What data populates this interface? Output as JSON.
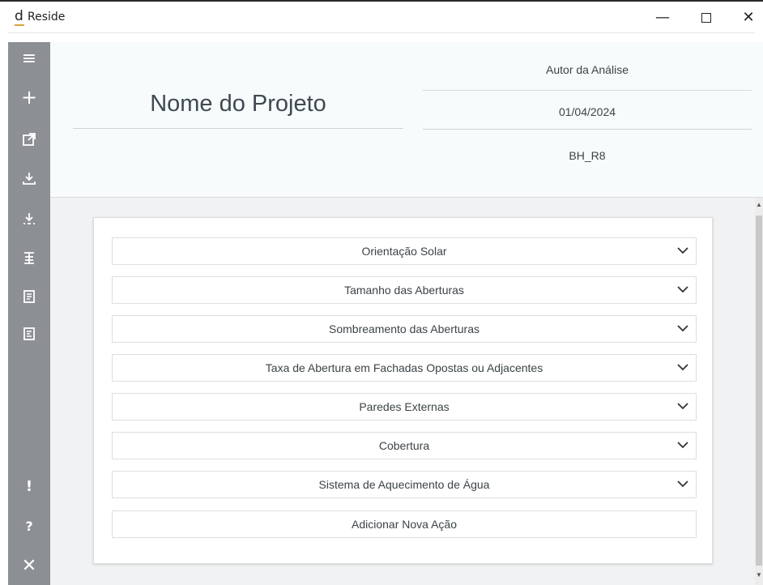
{
  "window": {
    "logo": "d",
    "title": "Reside",
    "minimize_glyph": "—",
    "close_glyph": "✕"
  },
  "sidebar": {
    "icons": [
      {
        "name": "menu-icon",
        "glyph": "≡"
      },
      {
        "name": "add-icon",
        "glyph": "+"
      },
      {
        "name": "open-external-icon",
        "glyph": "⧉"
      },
      {
        "name": "download-icon",
        "glyph": "⤓"
      },
      {
        "name": "import-icon",
        "glyph": "⤓"
      },
      {
        "name": "align-icon",
        "glyph": "☰"
      },
      {
        "name": "document-icon",
        "glyph": "▤"
      },
      {
        "name": "report-icon",
        "glyph": "▤"
      },
      {
        "name": "alert-icon",
        "glyph": "!"
      },
      {
        "name": "help-icon",
        "glyph": "?"
      },
      {
        "name": "close-icon",
        "glyph": "✕"
      }
    ]
  },
  "header": {
    "project_name": "Nome do Projeto",
    "author": "Autor da Análise",
    "date": "01/04/2024",
    "code": "BH_R8"
  },
  "actions": [
    {
      "label": "Orientação Solar",
      "expandable": true
    },
    {
      "label": "Tamanho das Aberturas",
      "expandable": true
    },
    {
      "label": "Sombreamento das Aberturas",
      "expandable": true
    },
    {
      "label": "Taxa de Abertura em Fachadas Opostas ou Adjacentes",
      "expandable": true
    },
    {
      "label": "Paredes Externas",
      "expandable": true
    },
    {
      "label": "Cobertura",
      "expandable": true
    },
    {
      "label": "Sistema de Aquecimento de Água",
      "expandable": true
    },
    {
      "label": "Adicionar Nova Ação",
      "expandable": false
    }
  ],
  "colors": {
    "sidebar": "#8c8f93",
    "header_bg": "#f7fbfc",
    "content_bg": "#f1f2f3",
    "logo_accent": "#d6a33a"
  }
}
